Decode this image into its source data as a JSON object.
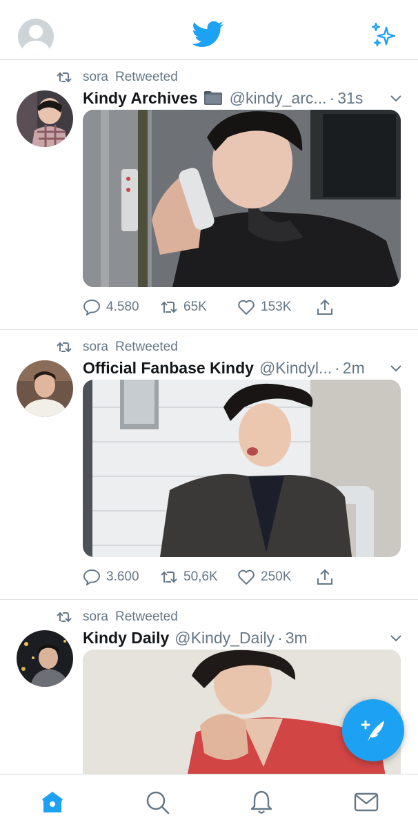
{
  "colors": {
    "accent": "#1da1f2",
    "muted": "#657786",
    "text": "#14171a",
    "divider": "#e1e4e6"
  },
  "header": {
    "profile_icon": "profile-avatar-icon",
    "logo_icon": "twitter-bird-icon",
    "sparkle_icon": "sparkle-icon"
  },
  "tweets": [
    {
      "retweet_by": "sora",
      "retweet_label": "Retweeted",
      "name": "Kindy Archives",
      "handle": "@kindy_arc...",
      "time": "31s",
      "media_icon": "photo-man-on-phone",
      "replies": "4.580",
      "retweets": "65K",
      "likes": "153K"
    },
    {
      "retweet_by": "sora",
      "retweet_label": "Retweeted",
      "name": "Official Fanbase Kindy",
      "handle": "@Kindyl...",
      "time": "2m",
      "media_icon": "photo-man-leather-jacket",
      "replies": "3.600",
      "retweets": "50,6K",
      "likes": "250K"
    },
    {
      "retweet_by": "sora",
      "retweet_label": "Retweeted",
      "name": "Kindy Daily",
      "handle": "@Kindy_Daily",
      "time": "3m",
      "media_icon": "photo-man-red-shirt"
    }
  ],
  "fab": {
    "icon": "compose-tweet-icon"
  },
  "bottom_nav": [
    "home-icon",
    "search-icon",
    "notifications-icon",
    "messages-icon"
  ]
}
